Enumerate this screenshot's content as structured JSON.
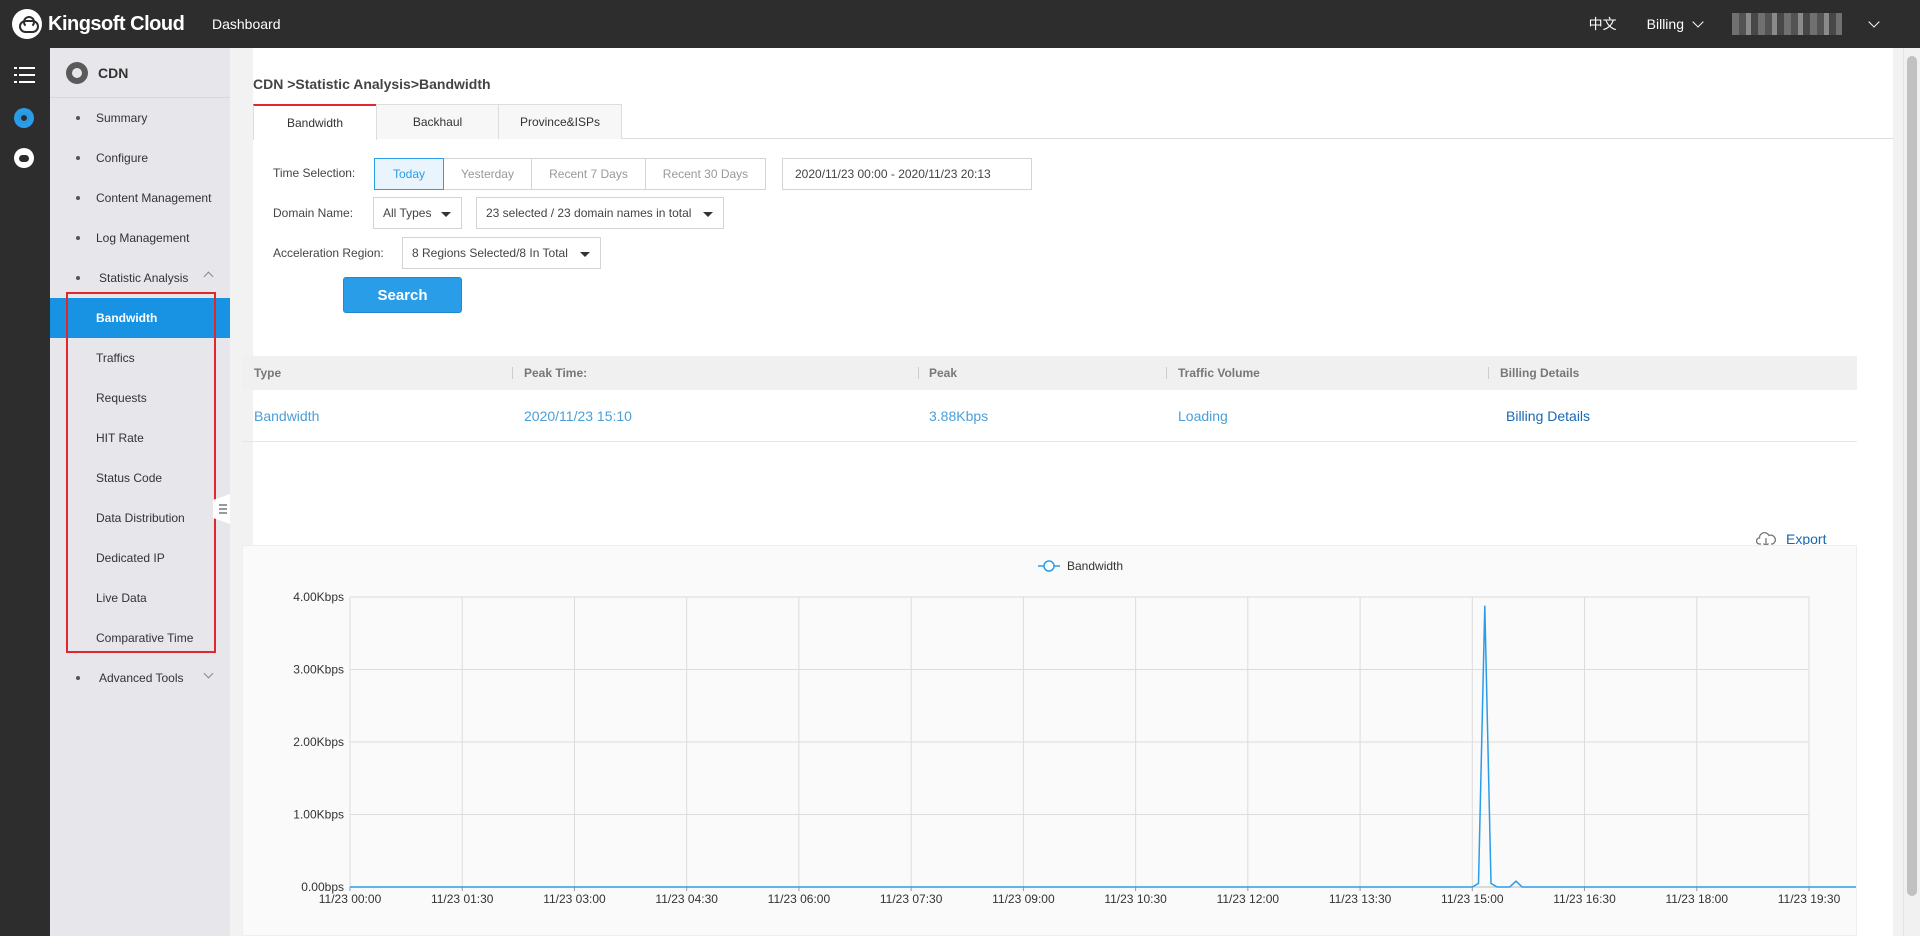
{
  "topbar": {
    "logo_text": "Kingsoft Cloud",
    "dashboard_label": "Dashboard",
    "language_label": "中文",
    "billing_label": "Billing"
  },
  "sidebar": {
    "title": "CDN",
    "items": [
      {
        "label": "Summary"
      },
      {
        "label": "Configure"
      },
      {
        "label": "Content Management"
      },
      {
        "label": "Log Management"
      },
      {
        "label": "Statistic Analysis"
      }
    ],
    "sub_items": [
      {
        "label": "Bandwidth"
      },
      {
        "label": "Traffics"
      },
      {
        "label": "Requests"
      },
      {
        "label": "HIT Rate"
      },
      {
        "label": "Status Code"
      },
      {
        "label": "Data Distribution"
      },
      {
        "label": "Dedicated IP"
      },
      {
        "label": "Live Data"
      },
      {
        "label": "Comparative Time"
      }
    ],
    "advanced_tools_label": "Advanced Tools"
  },
  "breadcrumb": "CDN >Statistic Analysis>Bandwidth",
  "tabs": [
    {
      "label": "Bandwidth"
    },
    {
      "label": "Backhaul"
    },
    {
      "label": "Province&ISPs"
    }
  ],
  "filters": {
    "time_label": "Time Selection:",
    "time_options": [
      {
        "label": "Today"
      },
      {
        "label": "Yesterday"
      },
      {
        "label": "Recent 7 Days"
      },
      {
        "label": "Recent 30 Days"
      }
    ],
    "date_range": "2020/11/23 00:00 - 2020/11/23 20:13",
    "domain_label": "Domain Name:",
    "domain_type": "All Types",
    "domain_selection": "23 selected / 23 domain names in total",
    "region_label": "Acceleration Region:",
    "region_selection": "8 Regions Selected/8 In Total",
    "search_label": "Search"
  },
  "summary_table": {
    "headers": [
      "Type",
      "Peak Time:",
      "Peak",
      "Traffic Volume",
      "Billing Details"
    ],
    "row": {
      "type": "Bandwidth",
      "peak_time": "2020/11/23 15:10",
      "peak": "3.88Kbps",
      "traffic_volume": "Loading",
      "billing": "Billing Details"
    }
  },
  "export_label": "Export",
  "colors": {
    "accent": "#2a9de8",
    "active_sidebar": "#1893e4",
    "highlight_red": "#e0272d",
    "link": "#1768b3"
  },
  "chart_data": {
    "type": "line",
    "legend": [
      "Bandwidth"
    ],
    "ylabel": "",
    "xlabel": "",
    "y_ticks": [
      "0.00bps",
      "1.00Kbps",
      "2.00Kbps",
      "3.00Kbps",
      "4.00Kbps"
    ],
    "ylim": [
      0,
      4
    ],
    "y_unit": "Kbps",
    "x_ticks": [
      "11/23 00:00",
      "11/23 01:30",
      "11/23 03:00",
      "11/23 04:30",
      "11/23 06:00",
      "11/23 07:30",
      "11/23 09:00",
      "11/23 10:30",
      "11/23 12:00",
      "11/23 13:30",
      "11/23 15:00",
      "11/23 16:30",
      "11/23 18:00",
      "11/23 19:30"
    ],
    "series": [
      {
        "name": "Bandwidth",
        "color": "#2a9de8",
        "points": [
          {
            "x": "11/23 00:00",
            "y": 0
          },
          {
            "x": "11/23 15:00",
            "y": 0
          },
          {
            "x": "11/23 15:05",
            "y": 0.05
          },
          {
            "x": "11/23 15:10",
            "y": 3.88
          },
          {
            "x": "11/23 15:15",
            "y": 0.05
          },
          {
            "x": "11/23 15:20",
            "y": 0
          },
          {
            "x": "11/23 15:30",
            "y": 0
          },
          {
            "x": "11/23 15:35",
            "y": 0.08
          },
          {
            "x": "11/23 15:40",
            "y": 0
          },
          {
            "x": "11/23 20:10",
            "y": 0
          }
        ]
      }
    ]
  }
}
